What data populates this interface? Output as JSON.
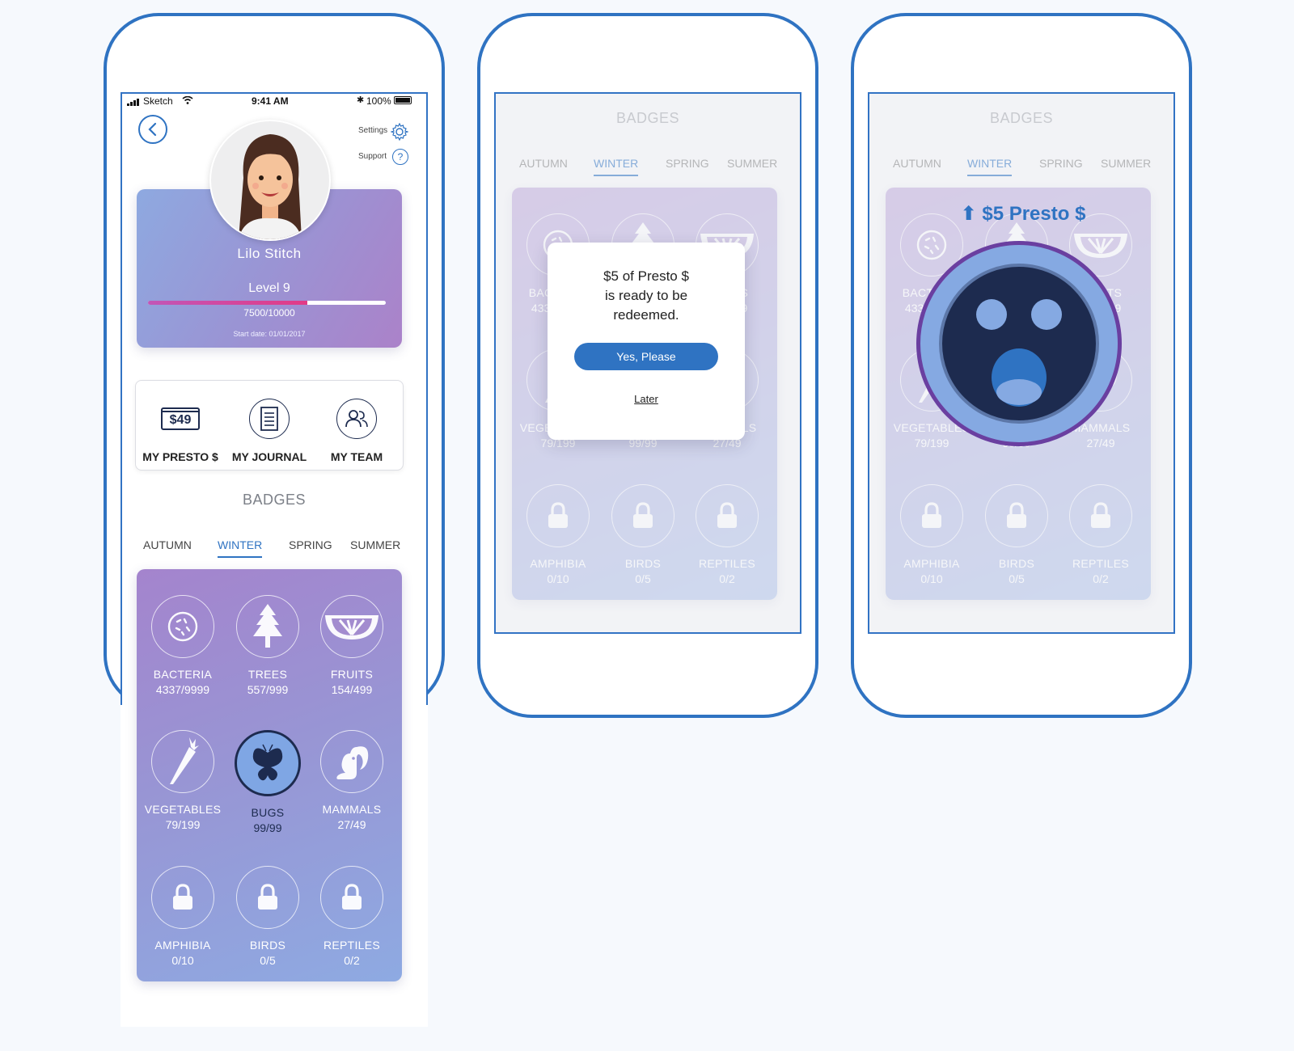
{
  "status_bar": {
    "carrier": "Sketch",
    "time": "9:41 AM",
    "battery": "100%"
  },
  "header": {
    "settings_label": "Settings",
    "support_label": "Support"
  },
  "profile": {
    "name": "Lilo Stitch",
    "level": "Level 9",
    "xp": "7500/10000",
    "xp_progress": 0.67,
    "start_date": "Start date: 01/01/2017"
  },
  "shortcuts": [
    {
      "label": "MY PRESTO $",
      "value": "$49",
      "icon": "presto-card-icon"
    },
    {
      "label": "MY JOURNAL",
      "icon": "journal-icon"
    },
    {
      "label": "MY TEAM",
      "icon": "team-icon"
    }
  ],
  "badges_title": "BADGES",
  "tabs": [
    "AUTUMN",
    "WINTER",
    "SPRING",
    "SUMMER"
  ],
  "active_tab": "WINTER",
  "badges": [
    {
      "label": "BACTERIA",
      "count": "4337/9999",
      "icon": "bacteria-icon"
    },
    {
      "label": "TREES",
      "count": "557/999",
      "icon": "tree-icon"
    },
    {
      "label": "FRUITS",
      "count": "154/499",
      "icon": "fruit-icon"
    },
    {
      "label": "VEGETABLES",
      "count": "79/199",
      "icon": "carrot-icon"
    },
    {
      "label": "BUGS",
      "count": "99/99",
      "icon": "butterfly-icon"
    },
    {
      "label": "MAMMALS",
      "count": "27/49",
      "icon": "squirrel-icon"
    },
    {
      "label": "AMPHIBIA",
      "count": "0/10",
      "icon": "lock-icon"
    },
    {
      "label": "BIRDS",
      "count": "0/5",
      "icon": "lock-icon"
    },
    {
      "label": "REPTILES",
      "count": "0/2",
      "icon": "lock-icon"
    }
  ],
  "dialog": {
    "message_line1": "$5 of Presto $",
    "message_line2": "is ready to be",
    "message_line3": "redeemed.",
    "confirm_label": "Yes, Please",
    "later_label": "Later"
  },
  "reward": {
    "text": "$5 Presto $"
  },
  "colors": {
    "accent": "#2f73c2",
    "highlight": "#6a3fa0",
    "dark": "#1d2b4f"
  }
}
